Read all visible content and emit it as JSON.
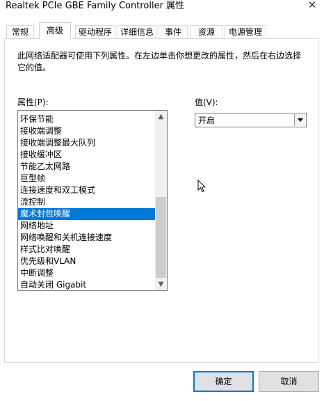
{
  "window": {
    "title": "Realtek PCIe GBE Family Controller 属性",
    "close_glyph": "✕"
  },
  "tabs": [
    {
      "label": "常规"
    },
    {
      "label": "高级"
    },
    {
      "label": "驱动程序"
    },
    {
      "label": "详细信息"
    },
    {
      "label": "事件"
    },
    {
      "label": "资源"
    },
    {
      "label": "电源管理"
    }
  ],
  "active_tab": "高级",
  "description": "此网络适配器可使用下列属性。在左边单击你想更改的属性，然后在右边选择它的值。",
  "property_label": "属性(P):",
  "value_label": "值(V):",
  "properties": [
    {
      "label": "环保节能"
    },
    {
      "label": "接收端调整"
    },
    {
      "label": "接收端调整最大队列"
    },
    {
      "label": "接收缓冲区"
    },
    {
      "label": "节能乙太网路"
    },
    {
      "label": "巨型帧"
    },
    {
      "label": "连接速度和双工模式"
    },
    {
      "label": "流控制"
    },
    {
      "label": "魔术封包唤醒"
    },
    {
      "label": "网络地址"
    },
    {
      "label": "网络唤醒和关机连接速度"
    },
    {
      "label": "样式比对唤醒"
    },
    {
      "label": "优先级和VLAN"
    },
    {
      "label": "中断调整"
    },
    {
      "label": "自动关闭 Gigabit"
    }
  ],
  "selected_property": "魔术封包唤醒",
  "value": {
    "selected": "开启"
  },
  "buttons": {
    "ok": "确定",
    "cancel": "取消"
  },
  "colors": {
    "selection": "#0078d7",
    "default_button_border": "#0078d7"
  }
}
